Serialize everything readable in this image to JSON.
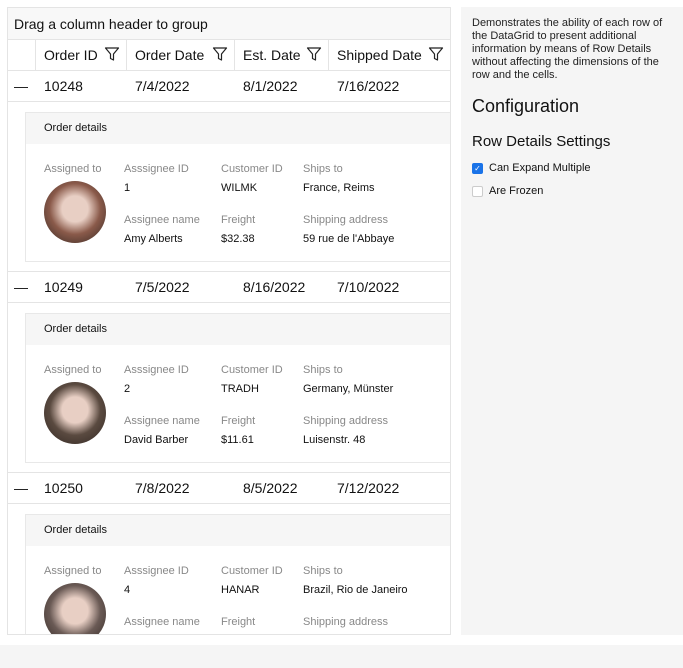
{
  "grid": {
    "group_panel": "Drag a column header to group",
    "columns": [
      "Order ID",
      "Order Date",
      "Est. Date",
      "Shipped Date"
    ],
    "details_title": "Order details",
    "detail_labels": {
      "assigned_to": "Assigned to",
      "assignee_id": "Asssignee ID",
      "customer_id": "Customer ID",
      "ships_to": "Ships to",
      "assignee_name": "Assignee name",
      "freight": "Freight",
      "shipping_address": "Shipping address"
    },
    "rows": [
      {
        "order_id": "10248",
        "order_date": "7/4/2022",
        "est_date": "8/1/2022",
        "shipped_date": "7/16/2022",
        "assignee_id": "1",
        "customer_id": "WILMK",
        "ships_to": "France, Reims",
        "assignee_name": "Amy Alberts",
        "freight": "$32.38",
        "shipping_address": "59 rue de l'Abbaye",
        "avatar_color": "#8a5a4a"
      },
      {
        "order_id": "10249",
        "order_date": "7/5/2022",
        "est_date": "8/16/2022",
        "shipped_date": "7/10/2022",
        "assignee_id": "2",
        "customer_id": "TRADH",
        "ships_to": "Germany, Münster",
        "assignee_name": "David Barber",
        "freight": "$11.61",
        "shipping_address": "Luisenstr. 48",
        "avatar_color": "#5a4a40"
      },
      {
        "order_id": "10250",
        "order_date": "7/8/2022",
        "est_date": "8/5/2022",
        "shipped_date": "7/12/2022",
        "assignee_id": "4",
        "customer_id": "HANAR",
        "ships_to": "Brazil, Rio de Janeiro",
        "assignee_name": "",
        "freight": "",
        "shipping_address": "",
        "avatar_color": "#6a5a55"
      }
    ]
  },
  "side": {
    "description": "Demonstrates the ability of each row of the DataGrid to present additional information by means of Row Details without affecting the dimensions of the row and the cells.",
    "configuration": "Configuration",
    "settings_title": "Row Details Settings",
    "options": [
      {
        "label": "Can Expand Multiple",
        "checked": true
      },
      {
        "label": "Are Frozen",
        "checked": false
      }
    ]
  },
  "colors": {
    "accent": "#1a73e8"
  }
}
